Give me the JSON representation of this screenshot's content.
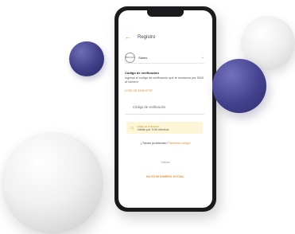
{
  "header": {
    "title": "Registro"
  },
  "country": {
    "flag": "BOLIVIA",
    "name": "Sabes"
  },
  "verification": {
    "title": "Código de verificación",
    "instruction": "Ingresa el código de verificación que te enviamos por SMS al número",
    "phone_number": "(+52) 55 2400 8737",
    "input_placeholder": "Código de verificación"
  },
  "notice": {
    "title": "Código de verificación",
    "body": "Válido por 3:00 minutos"
  },
  "help": {
    "question": "¿Tienes problemas?",
    "resend": "Reenviar código"
  },
  "buttons": {
    "validate": "Validar",
    "change_number": "NO ES MI NÚMERO ACTUAL"
  },
  "colors": {
    "accent": "#e8871e",
    "sphere_navy": "#44428e",
    "notice_bg": "#fdf6d6"
  }
}
